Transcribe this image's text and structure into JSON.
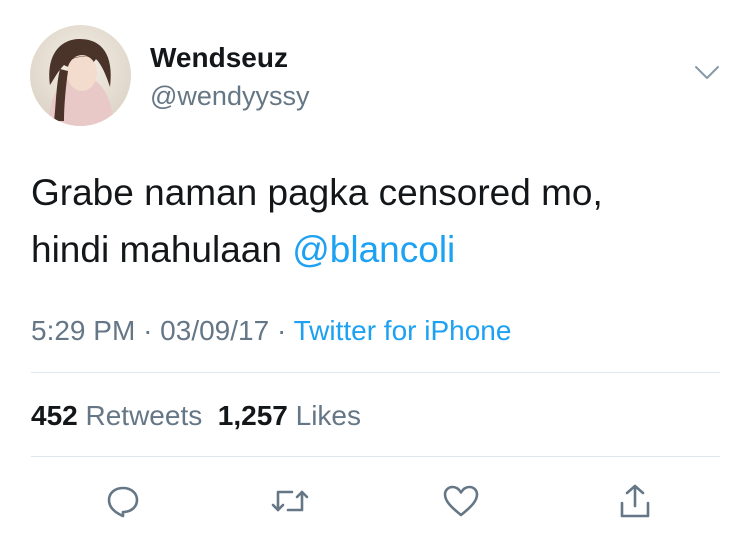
{
  "author": {
    "display_name": "Wendseuz",
    "handle": "@wendyyssy"
  },
  "tweet": {
    "text_line1": "Grabe naman pagka censored mo,",
    "text_line2_prefix": "hindi mahulaan ",
    "mention": "@blancoli"
  },
  "meta": {
    "time": "5:29 PM",
    "separator": "·",
    "date": "03/09/17",
    "source": "Twitter for iPhone"
  },
  "stats": {
    "retweets_count": "452",
    "retweets_label": "Retweets",
    "likes_count": "1,257",
    "likes_label": "Likes"
  },
  "icons": {
    "more": "chevron-down-icon",
    "reply": "reply-icon",
    "retweet": "retweet-icon",
    "like": "heart-icon",
    "share": "share-icon"
  },
  "colors": {
    "link": "#1da1f2",
    "secondary_text": "#657786",
    "primary_text": "#14171a",
    "divider": "#e1e8ed"
  }
}
